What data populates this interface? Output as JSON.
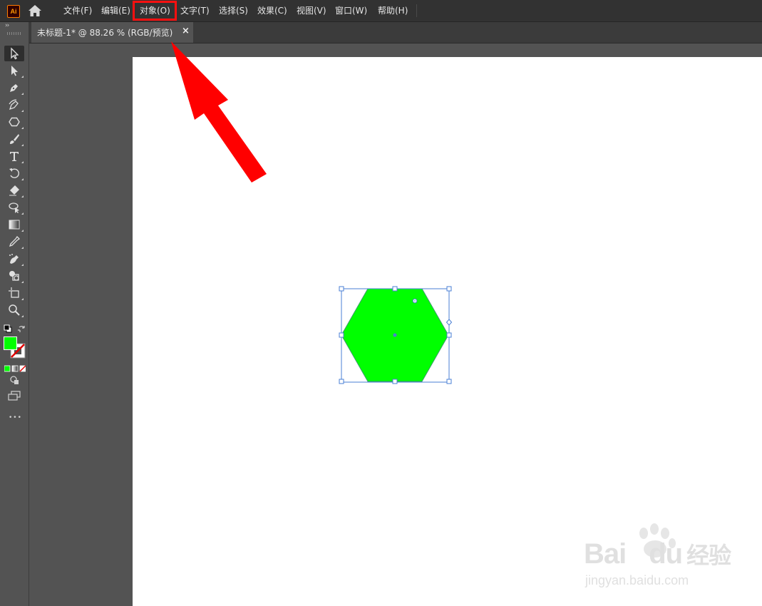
{
  "app": {
    "logo_text": "Ai"
  },
  "menu": {
    "items": [
      {
        "label": "文件(F)"
      },
      {
        "label": "编辑(E)"
      },
      {
        "label": "对象(O)"
      },
      {
        "label": "文字(T)"
      },
      {
        "label": "选择(S)"
      },
      {
        "label": "效果(C)"
      },
      {
        "label": "视图(V)"
      },
      {
        "label": "窗口(W)"
      },
      {
        "label": "帮助(H)"
      }
    ]
  },
  "document": {
    "tab_title": "未标题-1* @ 88.26 % (RGB/预览)",
    "close_glyph": "×"
  },
  "toolbar": {
    "collapse_glyph": "››",
    "more_glyph": "•••",
    "tools": [
      {
        "name": "selection-tool",
        "icon": "arrow-cursor-icon"
      },
      {
        "name": "direct-selection-tool",
        "icon": "filled-arrow-icon"
      },
      {
        "name": "pen-tool",
        "icon": "pen-nib-icon"
      },
      {
        "name": "curvature-tool",
        "icon": "curvature-pen-icon"
      },
      {
        "name": "polygon-tool",
        "icon": "hexagon-icon"
      },
      {
        "name": "paintbrush-tool",
        "icon": "brush-icon"
      },
      {
        "name": "type-tool",
        "icon": "type-t-icon"
      },
      {
        "name": "rotate-tool",
        "icon": "rotate-icon"
      },
      {
        "name": "eraser-tool",
        "icon": "eraser-icon"
      },
      {
        "name": "puppet-warp-tool",
        "icon": "lasso-pin-icon"
      },
      {
        "name": "gradient-tool",
        "icon": "gradient-icon"
      },
      {
        "name": "eyedropper-tool",
        "icon": "eyedropper-icon"
      },
      {
        "name": "symbol-sprayer-tool",
        "icon": "sprayer-icon"
      },
      {
        "name": "shape-builder-tool",
        "icon": "shape-builder-icon"
      },
      {
        "name": "artboard-tool",
        "icon": "artboard-icon"
      },
      {
        "name": "zoom-tool",
        "icon": "magnifier-icon"
      }
    ]
  },
  "colors": {
    "fill": "#00ff00",
    "selection": "#4a7fd4",
    "highlight_box": "#ff1010",
    "arrow": "#ff0000",
    "watermark": "#dcdcdc"
  },
  "watermark": {
    "brand_left": "Bai",
    "brand_right": "du",
    "brand_cn": "经验",
    "url": "jingyan.baidu.com"
  }
}
